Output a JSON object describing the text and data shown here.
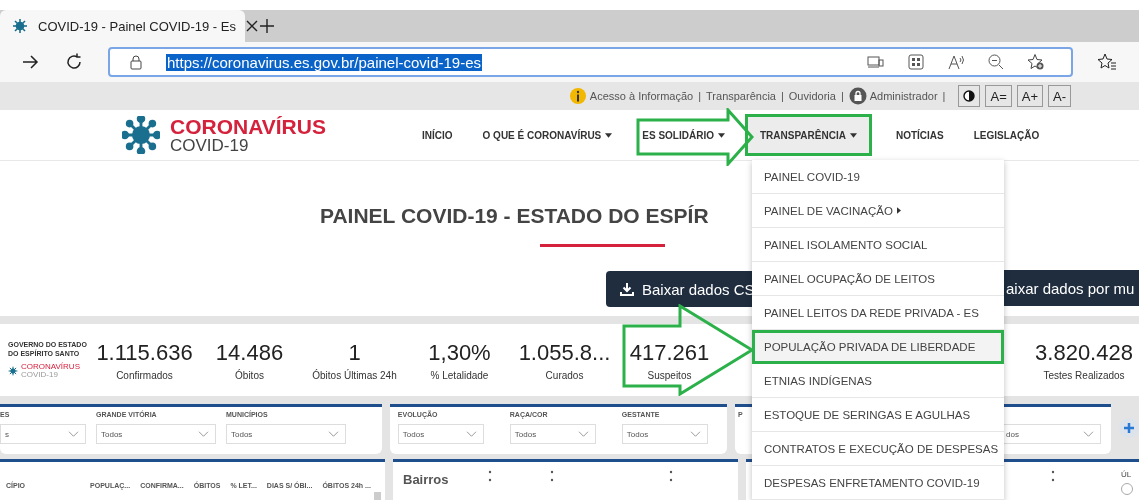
{
  "browser": {
    "tab_title": "COVID-19 - Painel COVID-19 - Es",
    "url": "https://coronavirus.es.gov.br/painel-covid-19-es"
  },
  "utility_bar": {
    "links": [
      "Acesso à Informação",
      "Transparência",
      "Ouvidoria",
      "Administrador"
    ],
    "separator": "|",
    "font_buttons": [
      "A=",
      "A+",
      "A-"
    ]
  },
  "site": {
    "logo_title": "CORONAVÍRUS",
    "logo_subtitle": "COVID-19",
    "nav": [
      {
        "label": "INÍCIO",
        "dropdown": false,
        "selected": false
      },
      {
        "label": "O QUE É CORONAVÍRUS",
        "dropdown": true,
        "selected": false
      },
      {
        "label": "ES SOLIDÁRIO",
        "dropdown": true,
        "selected": false
      },
      {
        "label": "TRANSPARÊNCIA",
        "dropdown": true,
        "selected": true
      },
      {
        "label": "NOTÍCIAS",
        "dropdown": false,
        "selected": false
      },
      {
        "label": "LEGISLAÇÃO",
        "dropdown": false,
        "selected": false
      }
    ]
  },
  "page_title": "PAINEL COVID-19 - ESTADO DO ESPÍR",
  "download_buttons": [
    {
      "label": "Baixar dados CS",
      "icon": true
    },
    {
      "label": "aixar dados por mu",
      "icon": false
    }
  ],
  "stats_logo": {
    "line1": "GOVERNO DO ESTADO",
    "line2": "DO ESPÍRITO SANTO",
    "brand": "CORONAVÍRUS",
    "brand_sub": "COVID-19"
  },
  "stats": [
    {
      "value": "1.115.636",
      "label": "Confirmados"
    },
    {
      "value": "14.486",
      "label": "Óbitos"
    },
    {
      "value": "1",
      "label": "Óbitos Últimas 24h"
    },
    {
      "value": "1,30%",
      "label": "% Letalidade"
    },
    {
      "value": "1.055.8...",
      "label": "Curados"
    },
    {
      "value": "417.261",
      "label": "Suspeitos"
    },
    {
      "value": "3.820.428",
      "label": "Testes Realizados"
    }
  ],
  "filter_panels": [
    {
      "filters": [
        {
          "label": "ES",
          "value": "s"
        },
        {
          "label": "GRANDE VITÓRIA",
          "value": "Todos"
        },
        {
          "label": "MUNICÍPIOS",
          "value": "Todos"
        }
      ]
    },
    {
      "filters": [
        {
          "label": "EVOLUÇÃO",
          "value": "Todos"
        },
        {
          "label": "RAÇA/COR",
          "value": "Todos"
        },
        {
          "label": "GESTANTE",
          "value": "Todos"
        }
      ]
    },
    {
      "filters": [
        {
          "label": "P"
        },
        {
          "value": "dos"
        }
      ]
    }
  ],
  "table": {
    "columns": [
      "CÍPIO",
      "POPULAÇ...",
      "CONFIRMA...",
      "ÓBITOS",
      "% LET...",
      "DIAS S/ ÓBI...",
      "ÓBITOS 24h ..."
    ]
  },
  "bairros_panel": {
    "title": "Bairros"
  },
  "right_panel": {
    "label": "ÚL",
    "radio_checked": false
  },
  "menu": {
    "items": [
      {
        "label": "PAINEL COVID-19",
        "submenu": false,
        "selected": false
      },
      {
        "label": "PAINEL DE VACINAÇÃO",
        "submenu": true,
        "selected": false
      },
      {
        "label": "PAINEL ISOLAMENTO SOCIAL",
        "submenu": false,
        "selected": false
      },
      {
        "label": "PAINEL OCUPAÇÃO DE LEITOS",
        "submenu": false,
        "selected": false
      },
      {
        "label": "PAINEL LEITOS DA REDE PRIVADA - ES",
        "submenu": false,
        "selected": false
      },
      {
        "label": "POPULAÇÃO PRIVADA DE LIBERDADE",
        "submenu": false,
        "selected": true
      },
      {
        "label": "ETNIAS INDÍGENAS",
        "submenu": false,
        "selected": false
      },
      {
        "label": "ESTOQUE DE SERINGAS E AGULHAS",
        "submenu": false,
        "selected": false
      },
      {
        "label": "CONTRATOS E EXECUÇÃO DE DESPESAS",
        "submenu": false,
        "selected": false
      },
      {
        "label": "DESPESAS ENFRETAMENTO COVID-19",
        "submenu": false,
        "selected": false
      }
    ]
  }
}
